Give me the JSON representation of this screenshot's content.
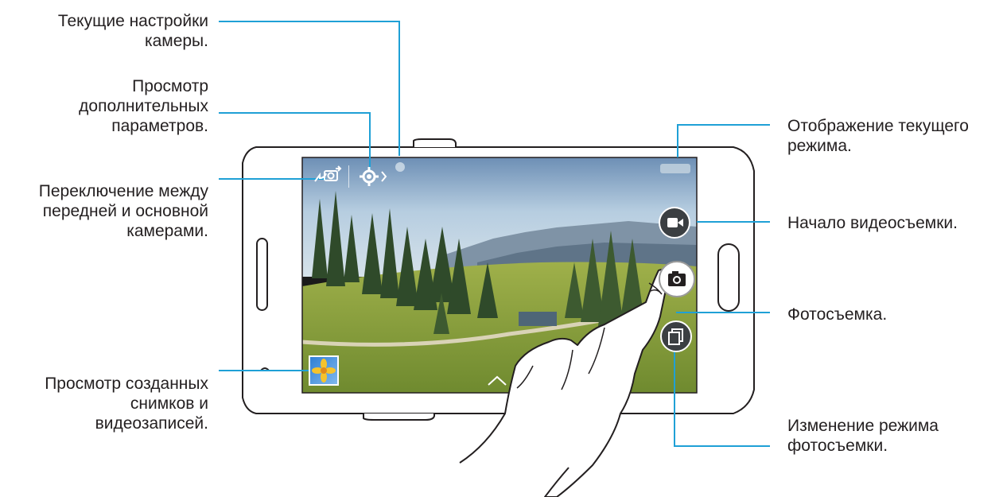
{
  "annotations": {
    "current_settings": [
      "Текущие настройки",
      "камеры."
    ],
    "more_options": [
      "Просмотр",
      "дополнительных",
      "параметров."
    ],
    "switch_camera": [
      "Переключение между",
      "передней и основной",
      "камерами."
    ],
    "view_gallery": [
      "Просмотр созданных",
      "снимков и",
      "видеозаписей."
    ],
    "current_mode": [
      "Отображение текущего",
      "режима."
    ],
    "start_video": [
      "Начало видеосъемки."
    ],
    "take_photo": [
      "Фотосъемка."
    ],
    "change_shooting_mode": [
      "Изменение режима",
      "фотосъемки."
    ]
  },
  "colors": {
    "callout_line": "#1fa0d6",
    "phone_outline": "#231f20",
    "text": "#231f20",
    "sky": "#9ec1dc",
    "grass": "#8aa040",
    "trees": "#2f4a2a",
    "shutter_button": "#ffffff",
    "round_button": "#3b3f42"
  },
  "icons": {
    "switch_camera": "camera-switch-icon",
    "settings": "gear-icon",
    "video": "video-camera-icon",
    "shutter": "camera-icon",
    "mode": "shooting-mode-icon",
    "gallery": "gallery-thumbnail-icon"
  }
}
